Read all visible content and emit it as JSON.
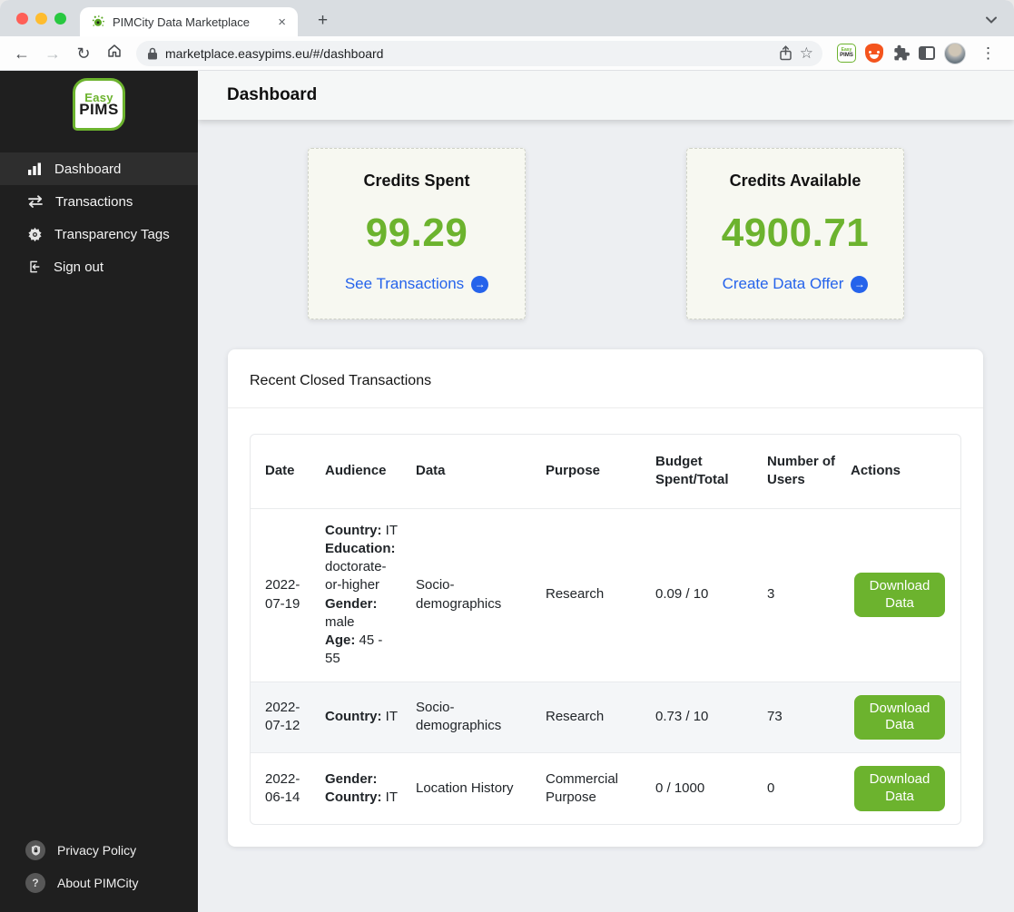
{
  "browser": {
    "tab": {
      "title": "PIMCity Data Marketplace"
    },
    "toolbar": {
      "url": "marketplace.easypims.eu/#/dashboard"
    },
    "icons": {
      "close": "×",
      "plus": "+",
      "back": "←",
      "forward": "→",
      "reload": "↻",
      "star": "☆",
      "kebab": "⋮"
    }
  },
  "sidebar": {
    "logo_top": "Easy",
    "logo_bottom": "PIMS",
    "items": [
      {
        "label": "Dashboard",
        "active": true
      },
      {
        "label": "Transactions",
        "active": false
      },
      {
        "label": "Transparency Tags",
        "active": false
      },
      {
        "label": "Sign out",
        "active": false
      }
    ],
    "footer": [
      {
        "label": "Privacy Policy",
        "icon": "shield-lock-icon"
      },
      {
        "label": "About PIMCity",
        "icon": "question-icon",
        "glyph": "?"
      }
    ]
  },
  "header": {
    "title": "Dashboard"
  },
  "stats": [
    {
      "title": "Credits Spent",
      "value": "99.29",
      "link": "See Transactions",
      "arrow": "→"
    },
    {
      "title": "Credits Available",
      "value": "4900.71",
      "link": "Create Data Offer",
      "arrow": "→"
    }
  ],
  "transactions": {
    "title": "Recent Closed Transactions",
    "download_label": "Download Data",
    "columns": [
      "Date",
      "Audience",
      "Data",
      "Purpose",
      "Budget Spent/Total",
      "Number of Users",
      "Actions"
    ],
    "rows": [
      {
        "date": "2022-07-19",
        "audience": [
          {
            "label": "Country:",
            "value": "IT"
          },
          {
            "label": "Education:",
            "value": "doctorate-or-higher"
          },
          {
            "label": "Gender:",
            "value": "male"
          },
          {
            "label": "Age:",
            "value": "45 - 55"
          }
        ],
        "data": "Socio-demographics",
        "purpose": "Research",
        "budget": "0.09 / 10",
        "users": "3"
      },
      {
        "date": "2022-07-12",
        "audience": [
          {
            "label": "Country:",
            "value": "IT"
          }
        ],
        "data": "Socio-demographics",
        "purpose": "Research",
        "budget": "0.73 / 10",
        "users": "73"
      },
      {
        "date": "2022-06-14",
        "audience": [
          {
            "label": "Gender:",
            "value": ""
          },
          {
            "label": "Country:",
            "value": "IT"
          }
        ],
        "data": "Location History",
        "purpose": "Commercial Purpose",
        "budget": "0 / 1000",
        "users": "0"
      }
    ]
  },
  "colors": {
    "accent_green": "#6cb32e",
    "link_blue": "#2563eb",
    "sidebar_bg": "#1f1f1f",
    "page_bg": "#edeff2",
    "row_stripe": "#f4f6f8"
  }
}
